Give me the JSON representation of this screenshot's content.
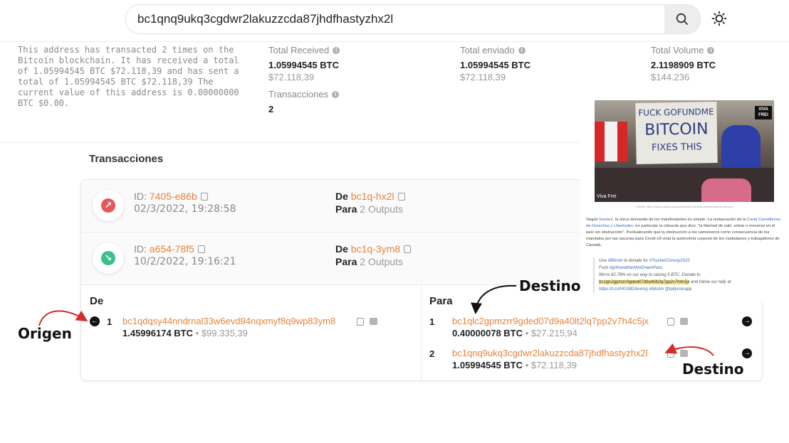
{
  "search": {
    "value": "bc1qnq9ukq3cgdwr2lakuzzcda87jhdfhastyzhx2l"
  },
  "icons": {
    "search": "search-icon",
    "theme": "sun-icon",
    "info": "info-icon",
    "copy": "copy-icon",
    "code": "code-icon",
    "arrow_out": "arrow-up-right-icon",
    "arrow_in": "arrow-down-right-icon",
    "arrow_right": "arrow-right-icon",
    "arrow_left": "arrow-left-icon"
  },
  "colors": {
    "accent": "#e8833a",
    "sent": "#e8565a",
    "received": "#3cc08a"
  },
  "summary": {
    "text": "This address has transacted 2 times on the Bitcoin blockchain. It has received a total of 1.05994545 BTC $72.118,39 and has sent a total of 1.05994545 BTC $72.118,39 The current value of this address is 0.00000000 BTC $0.00."
  },
  "stats": {
    "received": {
      "label": "Total Received",
      "btc": "1.05994545 BTC",
      "usd": "$72.118,39"
    },
    "sent": {
      "label": "Total enviado",
      "btc": "1.05994545 BTC",
      "usd": "$72.118,39"
    },
    "volume": {
      "label": "Total Volume",
      "btc": "2.1198909 BTC",
      "usd": "$144.236"
    },
    "transactions": {
      "label": "Transacciones",
      "value": "2"
    }
  },
  "transactions_title": "Transacciones",
  "transactions": [
    {
      "id_label": "ID:",
      "id": "7405-e86b",
      "date": "02/3/2022, 19:28:58",
      "from_label": "De",
      "from": "bc1q-hx2l",
      "to_label": "Para",
      "to": "2 Outputs"
    },
    {
      "id_label": "ID:",
      "id": "a654-78f5",
      "date": "10/2/2022, 19:16:21",
      "from_label": "De",
      "from": "bc1q-3ym8",
      "to_label": "Para",
      "to": "2 Outputs"
    }
  ],
  "detail": {
    "inputs_title": "De",
    "outputs_title": "Para",
    "inputs": [
      {
        "n": "1",
        "address": "bc1qdqsy44nndrnal33w6evd94nqxmyf8q9wp83ym8",
        "btc": "1.45996174 BTC",
        "sep": "•",
        "usd": "$99.335,39"
      }
    ],
    "outputs": [
      {
        "n": "1",
        "address": "bc1qlc2gpmzrr9gded07d9a40lt2lq7pp2v7h4c5jx",
        "btc": "0.40000078 BTC",
        "sep": "•",
        "usd": "$27.215,94"
      },
      {
        "n": "2",
        "address": "bc1qnq9ukq3cgdwr2lakuzzcda87jhdfhastyzhx2l",
        "btc": "1.05994545 BTC",
        "sep": "•",
        "usd": "$72.118,39"
      }
    ]
  },
  "annotations": {
    "origin": "Origen",
    "dest_top": "Destino",
    "dest_bottom": "Destino"
  },
  "article": {
    "sign_lines": [
      "FUCK GOFUNDME",
      "BITCOIN",
      "FIXES THIS"
    ],
    "logo": "VIVA FREI",
    "photo_credit": "Viva Frei",
    "caption": "Fuente: https://www.nasdaq.com/articles/the-canada-truckers-bitcoin-convoy",
    "para_prefix": "Según ",
    "para_link1": "fuentes",
    "para_mid": ", la única demanda de los manifestantes es simple: La restauración de la ",
    "para_link2": "Carta Canadiense de Derechos y Libertades",
    "para_rest": ", en particular la cláusula que dice: \"la libertad de salir, entrar o moverse en el país sin obstrucción\". Puntualizando que la obstrucción a los camioneros como consecuencia de los mandatos por las vacunas para Covid-19 viola la autonomía corporal de los ciudadanos y trabajadores de Canadá.",
    "quote_l1a": "Use ",
    "quote_l1b": "#Bitcoin",
    "quote_l1c": " to donate for ",
    "quote_l1d": "#TruckerConvoy2022",
    "quote_l2a": "Fuck ",
    "quote_l2b": "#gofoundme#NoGreenPass",
    "quote_l3": "We're 62.78% on our way to raising 5 BTC. Donate to",
    "quote_addr": "bc1qlc2gpmzrr9gded07d9a40lt2lq7pp2v7h4c5jx",
    "quote_l4": " and follow our tally at",
    "quote_l5a": "https://t.co/HGS8DXevmg",
    "quote_l5b": " #bitcoin @tallycoinapp"
  }
}
